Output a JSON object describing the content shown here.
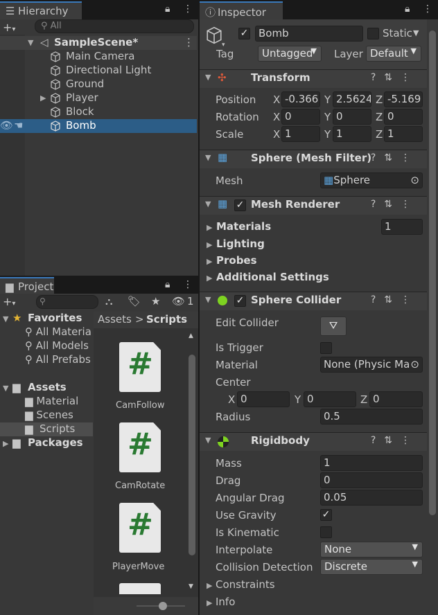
{
  "hierarchy": {
    "tab_label": "Hierarchy",
    "search_placeholder": "All",
    "scene_name": "SampleScene*",
    "items": [
      {
        "label": "Main Camera"
      },
      {
        "label": "Directional Light"
      },
      {
        "label": "Ground"
      },
      {
        "label": "Player"
      },
      {
        "label": "Block"
      },
      {
        "label": "Bomb"
      }
    ]
  },
  "inspector": {
    "tab_label": "Inspector",
    "object_name": "Bomb",
    "static_label": "Static",
    "tag_label": "Tag",
    "tag_value": "Untagged",
    "layer_label": "Layer",
    "layer_value": "Default",
    "transform": {
      "title": "Transform",
      "position_label": "Position",
      "rotation_label": "Rotation",
      "scale_label": "Scale",
      "x": "X",
      "y": "Y",
      "z": "Z",
      "position": [
        "-0.366",
        "2.5624",
        "-5.169"
      ],
      "rotation": [
        "0",
        "0",
        "0"
      ],
      "scale": [
        "1",
        "1",
        "1"
      ]
    },
    "mesh_filter": {
      "title": "Sphere (Mesh Filter)",
      "mesh_label": "Mesh",
      "mesh_value": "Sphere"
    },
    "mesh_renderer": {
      "title": "Mesh Renderer",
      "materials_label": "Materials",
      "materials_count": "1",
      "lighting_label": "Lighting",
      "probes_label": "Probes",
      "additional_label": "Additional Settings"
    },
    "sphere_collider": {
      "title": "Sphere Collider",
      "edit_label": "Edit Collider",
      "trigger_label": "Is Trigger",
      "material_label": "Material",
      "material_value": "None (Physic Ma",
      "center_label": "Center",
      "center": [
        "0",
        "0",
        "0"
      ],
      "radius_label": "Radius",
      "radius_value": "0.5"
    },
    "rigidbody": {
      "title": "Rigidbody",
      "mass_label": "Mass",
      "mass_value": "1",
      "drag_label": "Drag",
      "drag_value": "0",
      "angular_label": "Angular Drag",
      "angular_value": "0.05",
      "gravity_label": "Use Gravity",
      "kinematic_label": "Is Kinematic",
      "interpolate_label": "Interpolate",
      "interpolate_value": "None",
      "collision_label": "Collision Detection",
      "collision_value": "Discrete",
      "constraints_label": "Constraints",
      "info_label": "Info"
    }
  },
  "project": {
    "tab_label": "Project",
    "hidden_count": "1",
    "favorites_label": "Favorites",
    "favorites": [
      "All Materia",
      "All Models",
      "All Prefabs"
    ],
    "assets_label": "Assets",
    "asset_folders": [
      "Material",
      "Scenes",
      "Scripts"
    ],
    "packages_label": "Packages",
    "breadcrumb_root": "Assets",
    "breadcrumb_sep": ">",
    "breadcrumb_current": "Scripts",
    "files": [
      "CamFollow",
      "CamRotate",
      "PlayerMove"
    ],
    "script_glyph": "#"
  },
  "colors": {
    "selection": "#2c5d87",
    "accent_tab": "#3a79bb",
    "script_green": "#2a7a32"
  }
}
